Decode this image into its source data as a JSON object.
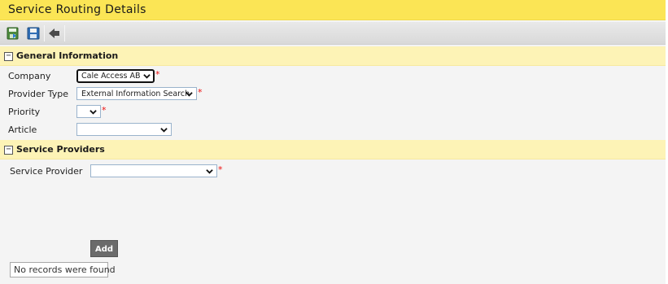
{
  "page": {
    "title": "Service Routing Details"
  },
  "toolbar": {
    "buttons": [
      {
        "icon": "save-and-close-icon"
      },
      {
        "icon": "save-icon"
      },
      {
        "icon": "back-icon"
      }
    ]
  },
  "general": {
    "header": "General Information",
    "toggle": "−",
    "company_label": "Company",
    "company_value": "Cale Access AB",
    "provider_type_label": "Provider Type",
    "provider_type_value": "External Information Search",
    "priority_label": "Priority",
    "priority_value": "",
    "article_label": "Article",
    "article_value": "",
    "required_mark": "*"
  },
  "providers": {
    "header": "Service Providers",
    "toggle": "−",
    "service_provider_label": "Service Provider",
    "service_provider_value": "",
    "add_label": "Add",
    "empty_message": "No records were found"
  },
  "colors": {
    "title_bar": "#fbe555",
    "section_header": "#fdf3b6",
    "required": "#ee1111",
    "add_button": "#6b6b6b"
  }
}
